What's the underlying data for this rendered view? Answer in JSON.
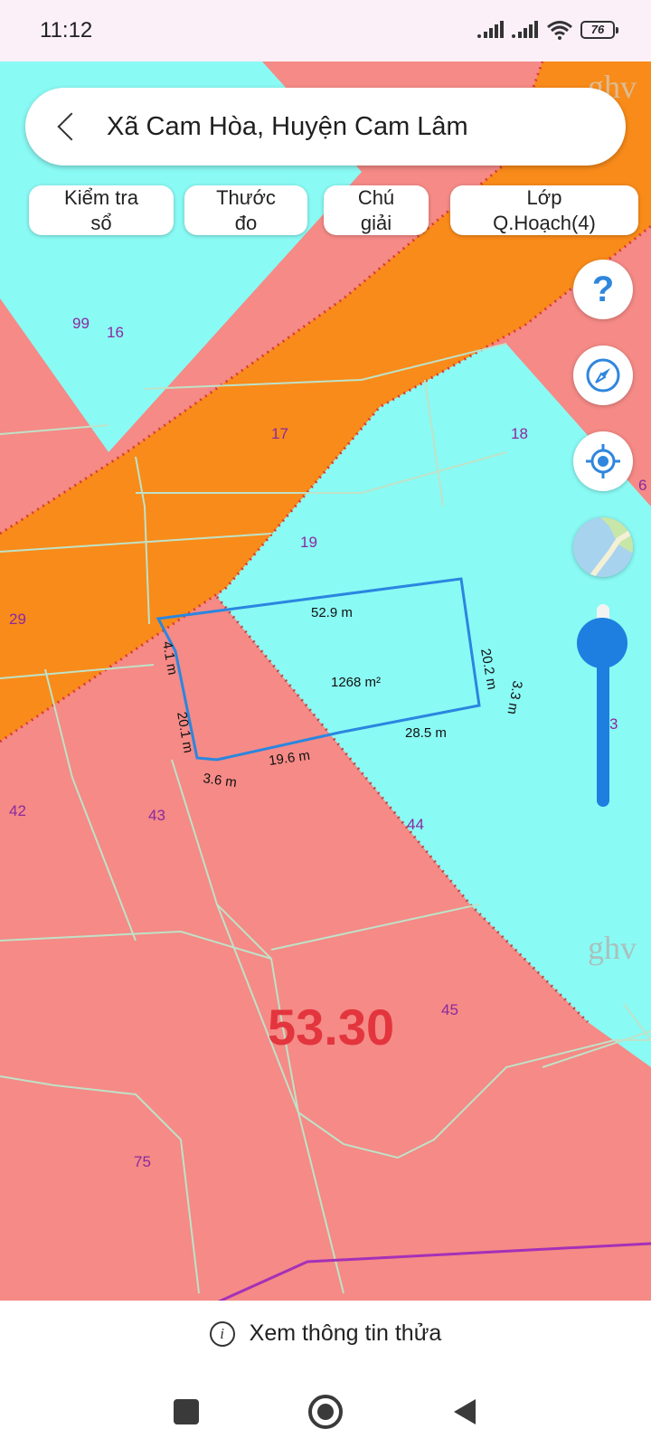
{
  "status_bar": {
    "time": "11:12",
    "battery": "76"
  },
  "search": {
    "title": "Xã Cam Hòa, Huyện Cam Lâm"
  },
  "chips": {
    "check_book": [
      "Kiểm tra",
      "sổ"
    ],
    "ruler": [
      "Thước",
      "đo"
    ],
    "legend": [
      "Chú",
      "giải"
    ],
    "layer": [
      "Lớp",
      "Q.Hoạch(4)"
    ]
  },
  "map": {
    "colors": {
      "residential": "#f58a86",
      "cyan": "#8afaf4",
      "road": "#f98b1a",
      "measure": "#2a86e0",
      "parcel_line": "#bfe2c8",
      "label": "#8a2aa0",
      "zone": "#e3353e"
    },
    "parcel_numbers": {
      "p99": "99",
      "p16": "16",
      "p17": "17",
      "p18": "18",
      "p19": "19",
      "p29": "29",
      "p42": "42",
      "p43": "43",
      "p44": "44",
      "p45": "45",
      "p75": "75",
      "p6": "6",
      "p3": "3"
    },
    "watermark": "ghv",
    "zone_value": "53.30",
    "measurements": {
      "top": "52.9 m",
      "right": "20.2 m",
      "right_small": "3.3 m",
      "left_top": "4.1 m",
      "left": "20.1 m",
      "bottom_left": "3.6 m",
      "bottom_mid": "19.6 m",
      "bottom_right": "28.5 m",
      "area": "1268 m²"
    }
  },
  "fabs": {
    "help": "?"
  },
  "bottom": {
    "info_label": "Xem thông tin thửa",
    "info_glyph": "i"
  }
}
